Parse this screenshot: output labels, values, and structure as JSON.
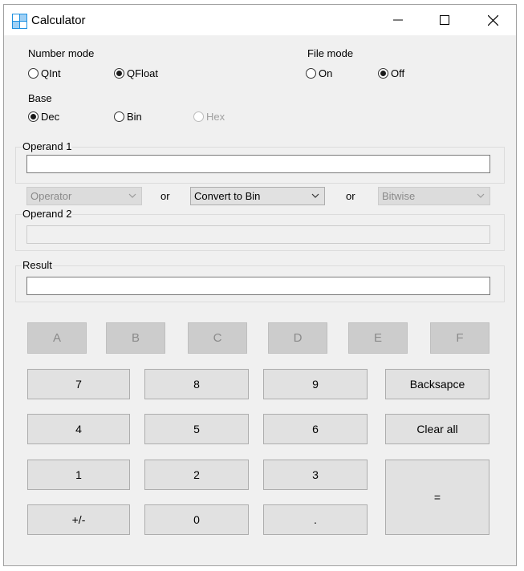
{
  "window": {
    "title": "Calculator"
  },
  "number_mode": {
    "label": "Number mode",
    "options": [
      "QInt",
      "QFloat"
    ],
    "selected": "QFloat"
  },
  "file_mode": {
    "label": "File mode",
    "options": [
      "On",
      "Off"
    ],
    "selected": "Off"
  },
  "base": {
    "label": "Base",
    "options": [
      "Dec",
      "Bin",
      "Hex"
    ],
    "selected": "Dec",
    "disabled": [
      "Hex"
    ]
  },
  "operand1": {
    "label": "Operand 1",
    "value": ""
  },
  "operator_row": {
    "operator": "Operator",
    "or1": "or",
    "convert": "Convert to Bin",
    "or2": "or",
    "bitwise": "Bitwise"
  },
  "operand2": {
    "label": "Operand 2",
    "value": ""
  },
  "result": {
    "label": "Result",
    "value": ""
  },
  "hex_keys": [
    "A",
    "B",
    "C",
    "D",
    "E",
    "F"
  ],
  "keys": {
    "k7": "7",
    "k8": "8",
    "k9": "9",
    "backspace": "Backsapce",
    "k4": "4",
    "k5": "5",
    "k6": "6",
    "clear": "Clear all",
    "k1": "1",
    "k2": "2",
    "k3": "3",
    "equals": "=",
    "sign": "+/-",
    "k0": "0",
    "dot": "."
  }
}
